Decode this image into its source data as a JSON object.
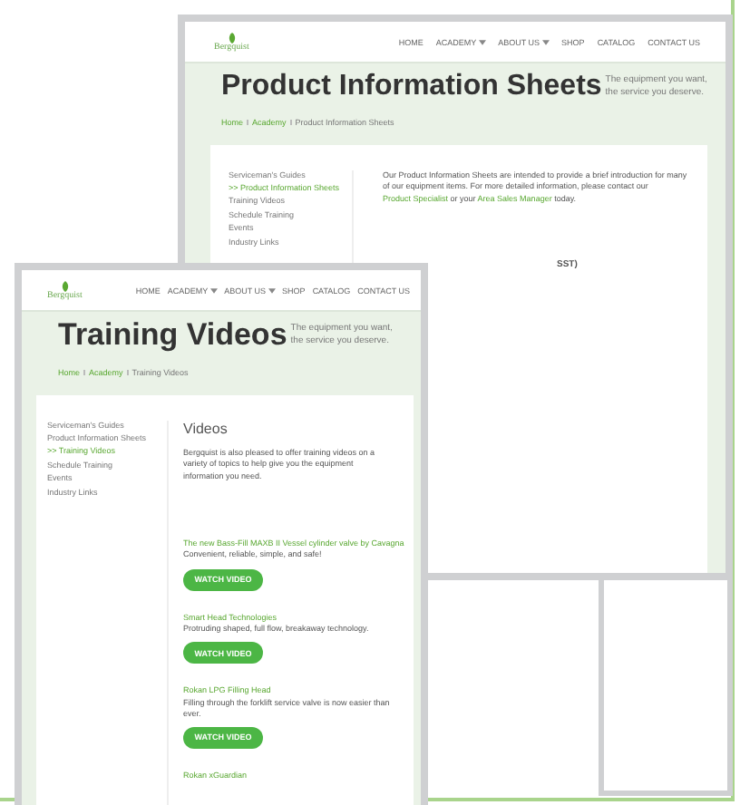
{
  "windows": [
    {
      "logo": "Bergquist",
      "nav": [
        {
          "label": "HOME",
          "dropdown": false
        },
        {
          "label": "ACADEMY",
          "dropdown": true
        },
        {
          "label": "ABOUT US",
          "dropdown": true
        },
        {
          "label": "SHOP",
          "dropdown": false
        },
        {
          "label": "CATALOG",
          "dropdown": false
        },
        {
          "label": "CONTACT US",
          "dropdown": false
        }
      ],
      "hero": {
        "title": "Product Information Sheets",
        "tagline": "The equipment you want, the service you deserve."
      },
      "breadcrumb": [
        "Home",
        "Academy",
        "Product Information Sheets"
      ],
      "sidebar": [
        {
          "label": "Serviceman's Guides",
          "selected": false
        },
        {
          "label": ">> Product Information Sheets",
          "selected": true
        },
        {
          "label": "Training Videos",
          "selected": false
        },
        {
          "label": "Schedule Training",
          "selected": false
        },
        {
          "label": "Events",
          "selected": false
        },
        {
          "label": "Industry Links",
          "selected": false
        }
      ],
      "content": {
        "intro": [
          {
            "kind": "text",
            "text": "Our Product Information Sheets are intended to provide a brief introduction for many of our equipment items. For more detailed information, please contact our "
          },
          {
            "kind": "link",
            "text": "Product Specialist"
          },
          {
            "kind": "text",
            "text": " or your "
          },
          {
            "kind": "link",
            "text": "Area Sales Manager"
          },
          {
            "kind": "text",
            "text": " today."
          }
        ],
        "peek_text": "SST)"
      }
    },
    {
      "logo": "Bergquist",
      "nav": [
        {
          "label": "HOME",
          "dropdown": false
        },
        {
          "label": "ACADEMY",
          "dropdown": true
        },
        {
          "label": "ABOUT US",
          "dropdown": true
        },
        {
          "label": "SHOP",
          "dropdown": false
        },
        {
          "label": "CATALOG",
          "dropdown": false
        },
        {
          "label": "CONTACT US",
          "dropdown": false
        }
      ],
      "hero": {
        "title": "Training Videos",
        "tagline": "The equipment you want, the service you deserve."
      },
      "breadcrumb": [
        "Home",
        "Academy",
        "Training Videos"
      ],
      "sidebar": [
        {
          "label": "Serviceman's Guides",
          "selected": false
        },
        {
          "label": "Product Information Sheets",
          "selected": false
        },
        {
          "label": ">> Training Videos",
          "selected": true
        },
        {
          "label": "Schedule Training",
          "selected": false
        },
        {
          "label": "Events",
          "selected": false
        },
        {
          "label": "Industry Links",
          "selected": false
        }
      ],
      "content": {
        "heading": "Videos",
        "intro": [
          {
            "kind": "text",
            "text": "Bergquist is also pleased to offer training videos on a variety of topics to help give you the equipment information you need."
          }
        ],
        "videos": [
          {
            "title": "The new Bass-Fill MAXB II Vessel cylinder valve by Cavagna",
            "description": "Convenient, reliable, simple, and safe!",
            "button": "WATCH VIDEO"
          },
          {
            "title": "Smart Head Technologies",
            "description": "Protruding shaped, full flow, breakaway technology.",
            "button": "WATCH VIDEO"
          },
          {
            "title": "Rokan LPG Filling Head",
            "description": "Filling through the forklift service valve is now easier than ever.",
            "button": "WATCH VIDEO"
          },
          {
            "title": "Rokan xGuardian"
          }
        ]
      }
    }
  ]
}
